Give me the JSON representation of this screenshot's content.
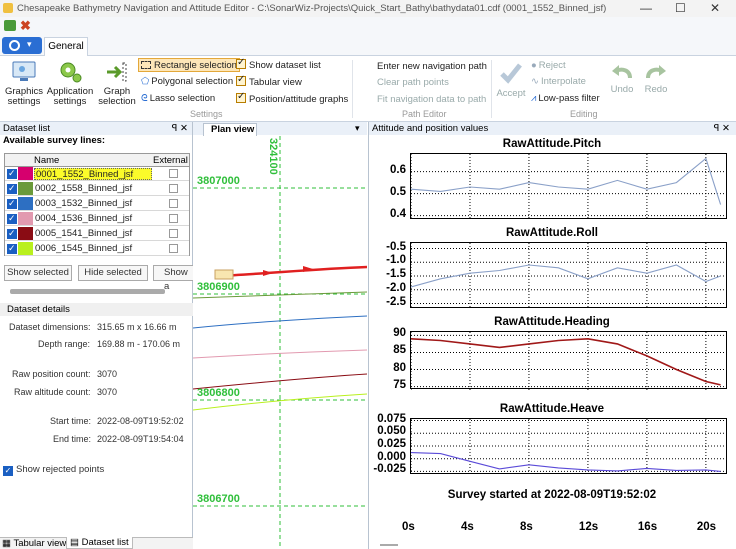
{
  "window": {
    "title": "Chesapeake Bathymetry Navigation and Attitude Editor - C:\\SonarWiz-Projects\\Quick_Start_Bathy\\bathydata01.cdf (0001_1552_Binned_jsf)",
    "controls": [
      "—",
      "☐",
      "✕"
    ]
  },
  "ribbon": {
    "tab": "General",
    "settings": {
      "graphics_settings": "Graphics settings",
      "application_settings": "Application settings",
      "graph_selection": "Graph selection",
      "rectangle_selection": "Rectangle selection",
      "polygonal_selection": "Polygonal selection",
      "lasso_selection": "Lasso selection",
      "show_dataset_list": "Show dataset list",
      "tabular_view": "Tabular view",
      "position_attitude_graphs": "Position/attitude graphs",
      "group_label": "Settings"
    },
    "path_editor": {
      "enter_new_path": "Enter new navigation path",
      "clear_path_points": "Clear path points",
      "fit_navigation": "Fit navigation data to path",
      "group_label": "Path Editor"
    },
    "editing": {
      "accept": "Accept",
      "reject": "Reject",
      "interpolate": "Interpolate",
      "low_pass_filter": "Low-pass filter",
      "undo": "Undo",
      "redo": "Redo",
      "group_label": "Editing"
    }
  },
  "dataset_list": {
    "header": "Dataset list",
    "pin": "ꟼ ✕",
    "available_label": "Available survey lines:",
    "col_name": "Name",
    "col_external": "External",
    "rows": [
      {
        "name": "0001_1552_Binned_jsf",
        "color": "#d6006e",
        "selected": true
      },
      {
        "name": "0002_1558_Binned_jsf",
        "color": "#6a9a3a",
        "selected": false
      },
      {
        "name": "0003_1532_Binned_jsf",
        "color": "#2d6fc2",
        "selected": false
      },
      {
        "name": "0004_1536_Binned_jsf",
        "color": "#e29ab0",
        "selected": false
      },
      {
        "name": "0005_1541_Binned_jsf",
        "color": "#8a0c14",
        "selected": false
      },
      {
        "name": "0006_1545_Binned_jsf",
        "color": "#b9f01e",
        "selected": false
      }
    ],
    "show_selected": "Show selected",
    "hide_selected": "Hide selected",
    "show_all": "Show a",
    "details_header": "Dataset details",
    "details": {
      "dimensions_label": "Dataset dimensions:",
      "dimensions_value": "315.65 m x 16.66 m",
      "depth_label": "Depth range:",
      "depth_value": "169.88 m - 170.06 m",
      "raw_pos_label": "Raw position count:",
      "raw_pos_value": "3070",
      "raw_alt_label": "Raw altitude count:",
      "raw_alt_value": "3070",
      "start_label": "Start time:",
      "start_value": "2022-08-09T19:52:02",
      "end_label": "End time:",
      "end_value": "2022-08-09T19:54:04"
    },
    "show_rejected": "Show rejected points",
    "bottom_tabs": [
      "Tabular view",
      "Dataset list"
    ]
  },
  "plan_view": {
    "tab": "Plan view",
    "dropdown": "▾",
    "northings": [
      "3807000",
      "3806900",
      "3806800",
      "3806700"
    ],
    "easting": "324100"
  },
  "attitude": {
    "header": "Attitude and position values",
    "pin": "ꟼ ✕",
    "graphs": [
      {
        "title": "RawAttitude.Pitch",
        "ticks": [
          "0.6",
          "0.5",
          "0.4"
        ],
        "color": "#8aa0c8"
      },
      {
        "title": "RawAttitude.Roll",
        "ticks": [
          "-0.5",
          "-1.0",
          "-1.5",
          "-2.0",
          "-2.5"
        ],
        "color": "#8aa0c8"
      },
      {
        "title": "RawAttitude.Heading",
        "ticks": [
          "90",
          "85",
          "80",
          "75"
        ],
        "color": "#a01818"
      },
      {
        "title": "RawAttitude.Heave",
        "ticks": [
          "0.075",
          "0.050",
          "0.025",
          "0.000",
          "-0.025"
        ],
        "color": "#5a4ad8"
      }
    ],
    "survey_started": "Survey started at 2022-08-09T19:52:02",
    "time_ticks": [
      "0s",
      "4s",
      "8s",
      "12s",
      "16s",
      "20s"
    ]
  },
  "chart_data": [
    {
      "type": "line",
      "title": "RawAttitude.Pitch",
      "x": [
        0,
        2,
        4,
        6,
        8,
        10,
        12,
        14,
        16,
        18,
        20,
        21
      ],
      "series": [
        {
          "values": [
            0.52,
            0.51,
            0.53,
            0.52,
            0.55,
            0.53,
            0.52,
            0.56,
            0.52,
            0.55,
            0.66,
            0.45
          ]
        }
      ],
      "ylim": [
        0.38,
        0.68
      ]
    },
    {
      "type": "line",
      "title": "RawAttitude.Roll",
      "x": [
        0,
        2,
        4,
        6,
        8,
        10,
        12,
        14,
        16,
        18,
        20,
        21
      ],
      "series": [
        {
          "values": [
            -1.9,
            -1.6,
            -1.4,
            -1.3,
            -1.1,
            -1.2,
            -1.6,
            -1.2,
            -1.4,
            -1.1,
            -1.7,
            -1.5
          ]
        }
      ],
      "ylim": [
        -2.7,
        -0.3
      ]
    },
    {
      "type": "line",
      "title": "RawAttitude.Heading",
      "x": [
        0,
        2,
        4,
        6,
        8,
        10,
        12,
        14,
        16,
        18,
        20,
        21
      ],
      "series": [
        {
          "values": [
            89,
            88.5,
            87.5,
            86.5,
            87.5,
            88.5,
            89,
            87.5,
            84,
            80,
            76.5,
            75.5
          ]
        }
      ],
      "ylim": [
        74,
        91
      ]
    },
    {
      "type": "line",
      "title": "RawAttitude.Heave",
      "x": [
        0,
        2,
        4,
        6,
        8,
        10,
        12,
        14,
        16,
        18,
        20,
        21
      ],
      "series": [
        {
          "values": [
            0.012,
            0.01,
            -0.005,
            -0.02,
            -0.012,
            -0.018,
            -0.022,
            -0.024,
            -0.019,
            -0.023,
            -0.022,
            -0.025
          ]
        }
      ],
      "ylim": [
        -0.032,
        0.078
      ]
    }
  ]
}
